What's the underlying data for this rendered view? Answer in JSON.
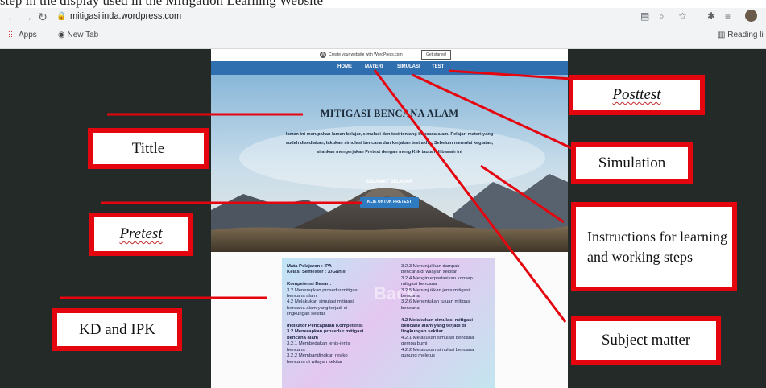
{
  "caption_fragment": "step in the display used in the Mitigation Learning Website",
  "browser": {
    "url": "mitigasilinda.wordpress.com",
    "bookmarks": {
      "apps": "Apps",
      "new_tab": "New Tab",
      "reading_list": "Reading li"
    }
  },
  "wp_bar": {
    "text": "Create your website with WordPress.com",
    "button": "Get started"
  },
  "site_menu": [
    "HOME",
    "MATERI",
    "SIMULASI",
    "TEST"
  ],
  "hero": {
    "title": "MITIGASI BENCANA ALAM",
    "description": "laman ini merupakan laman belajar, simulasi dan test tentang bencana alam. Pelajari materi yang sudah disediakan, lakukan simulasi bencana dan kerjakan test akhir. Sebelum memulai kegiatan, silahkan mengerjakan Pretest dengan meng Klik tautan di bawah ini",
    "greeting": "SELAMAT BELAJAR",
    "pretest_button": "KLIK UNTUK PRETEST"
  },
  "kd": {
    "watermark": "Back",
    "left_col": [
      {
        "text": "Mata Pelajaran     :      IPA",
        "bold": true
      },
      {
        "text": "Kelas/ Semester   :      X/Ganjil",
        "bold": true
      },
      {
        "text": "",
        "bold": false
      },
      {
        "text": "Kompetensi Dasar :",
        "bold": true
      },
      {
        "text": "  3.2 Menerapkan prosedur mitigasi",
        "bold": false
      },
      {
        "text": "        bencana alam",
        "bold": false
      },
      {
        "text": "  4.2 Melakukan simulasi mitigasi",
        "bold": false
      },
      {
        "text": "        bencana alam yang terjadi di",
        "bold": false
      },
      {
        "text": "        lingkungan sekitar.",
        "bold": false
      },
      {
        "text": "",
        "bold": false
      },
      {
        "text": "Indikator Pencapaian Kompetensi",
        "bold": true
      },
      {
        "text": "  3.2 Menerapkan prosedur mitigasi",
        "bold": true
      },
      {
        "text": "        bencana alam",
        "bold": true
      },
      {
        "text": "    3.2.1  Membedakan jenis-jenis",
        "bold": false
      },
      {
        "text": "              bencana",
        "bold": false
      },
      {
        "text": "    3.2.2  Membandingkan resiko",
        "bold": false
      },
      {
        "text": "              bencana di wilayah sekitar",
        "bold": false
      }
    ],
    "right_col": [
      {
        "text": "3.2.3  Menunjukkan dampak",
        "bold": false
      },
      {
        "text": "          bencana di wilayah sekitar",
        "bold": false
      },
      {
        "text": "3.2.4  Menginterpretasikan konsep",
        "bold": false
      },
      {
        "text": "          mitigasi bencana",
        "bold": false
      },
      {
        "text": "3.2.5  Menunjukkan jenis mitigasi",
        "bold": false
      },
      {
        "text": "          bencana",
        "bold": false
      },
      {
        "text": "3.2.6  Menentukan tujuan mitigasi",
        "bold": false
      },
      {
        "text": "          bencana",
        "bold": false
      },
      {
        "text": "",
        "bold": false
      },
      {
        "text": "4.2 Melakukan simulasi mitigasi",
        "bold": true
      },
      {
        "text": "     bencana alam yang terjadi di",
        "bold": true
      },
      {
        "text": "     lingkungan sekitar.",
        "bold": true
      },
      {
        "text": "4.2.1  Melakukan simulasi bencana",
        "bold": false
      },
      {
        "text": "          gempa bumi",
        "bold": false
      },
      {
        "text": "4.2.2  Melakukan simulasi bencana",
        "bold": false
      },
      {
        "text": "          gunung meletus",
        "bold": false
      }
    ]
  },
  "callouts": {
    "tittle": "Tittle",
    "pretest": "Pretest",
    "kd_ipk": "KD and IPK",
    "posttest": "Posttest",
    "simulation": "Simulation",
    "instructions": "Instructions for learning and working steps",
    "subject_matter": "Subject matter"
  },
  "colors": {
    "callout_border": "#e5050f",
    "site_menu": "#2f6fb0",
    "page_background": "#232a27"
  }
}
